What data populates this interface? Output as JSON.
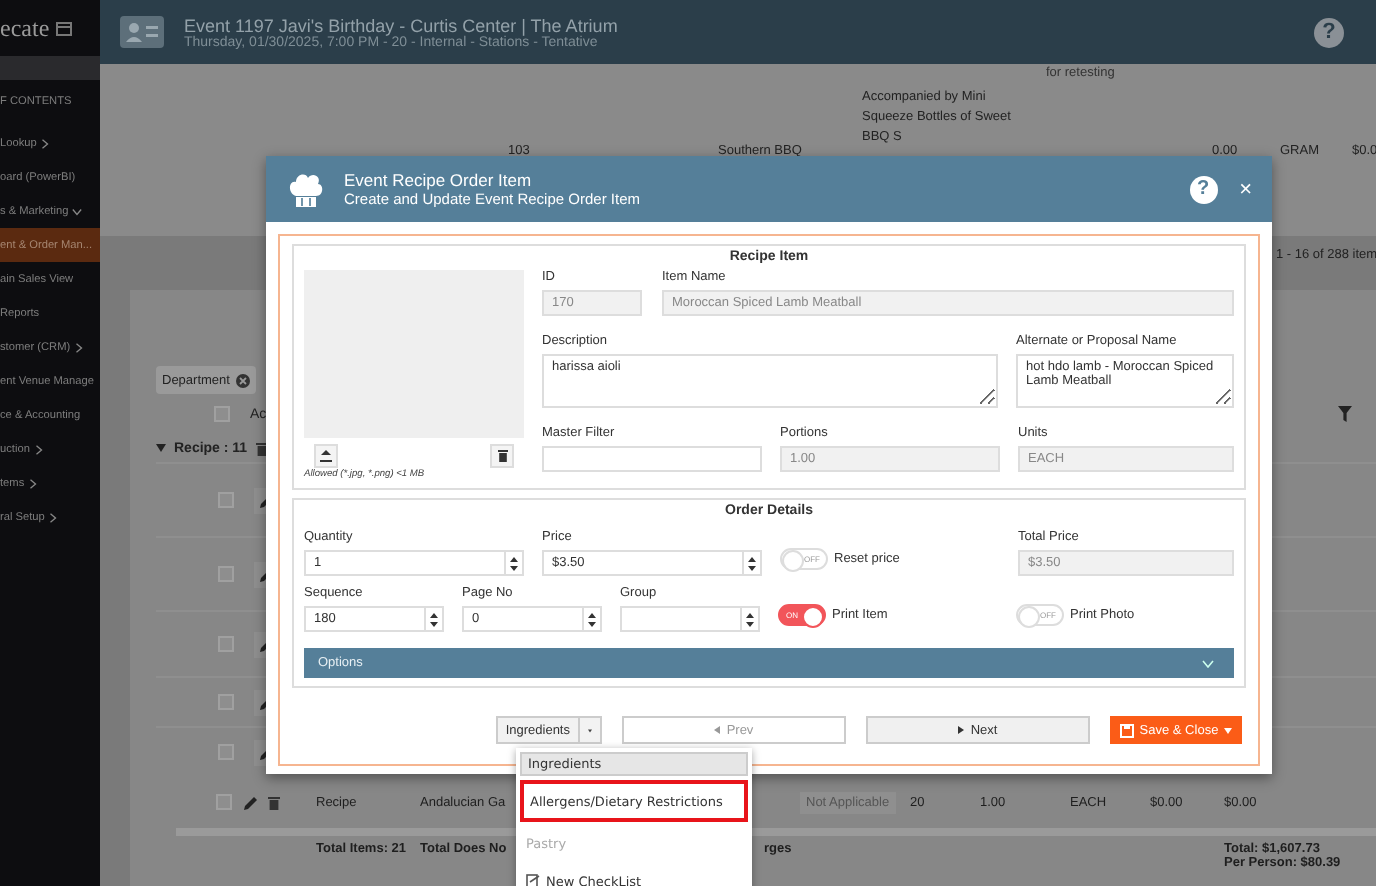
{
  "app": {
    "logo_text": "ecate",
    "header": {
      "title": "Event 1197 Javi's Birthday - Curtis Center | The Atrium",
      "subtitle": "Thursday, 01/30/2025, 7:00 PM - 20 - Internal - Stations - Tentative",
      "help": "?"
    }
  },
  "sidebar": {
    "heading": "F CONTENTS",
    "items": [
      {
        "label": "Lookup",
        "selected": false,
        "submenu": true,
        "expanded": false
      },
      {
        "label": "oard (PowerBI)",
        "selected": false
      },
      {
        "label": "s & Marketing",
        "selected": false,
        "submenu": true,
        "expanded": true
      },
      {
        "label": "ent & Order Man...",
        "selected": true
      },
      {
        "label": "ain Sales View",
        "selected": false
      },
      {
        "label": "Reports",
        "selected": false
      },
      {
        "label": "stomer (CRM)",
        "selected": false,
        "submenu": true,
        "expanded": false
      },
      {
        "label": "ent Venue Manage",
        "selected": false
      },
      {
        "label": "ce & Accounting",
        "selected": false
      },
      {
        "label": "uction",
        "selected": false,
        "submenu": true,
        "expanded": false
      },
      {
        "label": "tems",
        "selected": false,
        "submenu": true,
        "expanded": false
      },
      {
        "label": "ral Setup",
        "selected": false,
        "submenu": true,
        "expanded": false
      }
    ]
  },
  "background": {
    "top_row": {
      "note": "for retesting",
      "number": "103",
      "station": "Southern BBQ",
      "description": "Accompanied by Mini Squeeze Bottles of Sweet BBQ S",
      "quantity": "0.00",
      "unit": "GRAM",
      "price": "$0.0"
    },
    "pager": "1 - 16 of 288 item",
    "department_chip": "Department",
    "column_header": "Ac",
    "header_checked": false,
    "rows": [
      {
        "checked": false
      },
      {
        "checked": false
      },
      {
        "checked": false
      },
      {
        "checked": false
      },
      {
        "checked": false
      }
    ],
    "group": "Recipe : 11",
    "last_row": {
      "checked": false,
      "type": "Recipe",
      "name": "Andalucian Ga",
      "status": "Not Applicable",
      "guests": "20",
      "quantity": "1.00",
      "unit": "EACH",
      "price": "$0.00",
      "total": "$0.00"
    },
    "totals": {
      "items": "Total Items: 21",
      "note_start": "Total Does No",
      "note_end": "rges",
      "total": "Total: $1,607.73",
      "per_person": "Per Person: $80.39"
    }
  },
  "modal": {
    "title": "Event Recipe Order Item",
    "subtitle": "Create and Update Event Recipe Order Item",
    "help": "?",
    "close": "×",
    "recipe_item": {
      "heading": "Recipe Item",
      "image_note": "Allowed (*.jpg, *.png) <1 MB",
      "id": {
        "label": "ID",
        "value": "170",
        "disabled": true
      },
      "item_name": {
        "label": "Item Name",
        "value": "Moroccan Spiced Lamb Meatball",
        "disabled": true
      },
      "description": {
        "label": "Description",
        "value": "harissa aioli",
        "disabled": false
      },
      "alternate_name": {
        "label": "Alternate or Proposal Name",
        "value": "hot hdo lamb - Moroccan Spiced Lamb Meatball",
        "disabled": false
      },
      "master_filter": {
        "label": "Master Filter"
      },
      "portions": {
        "label": "Portions",
        "value": "1.00",
        "disabled": true
      },
      "units": {
        "label": "Units",
        "value": "EACH",
        "disabled": true
      }
    },
    "order_details": {
      "heading": "Order Details",
      "quantity": {
        "label": "Quantity",
        "value": "1"
      },
      "price": {
        "label": "Price",
        "value": "$3.50"
      },
      "reset_price": {
        "label": "Reset price",
        "on": false,
        "switch_text": "OFF"
      },
      "total_price": {
        "label": "Total Price",
        "value": "$3.50",
        "disabled": true
      },
      "sequence": {
        "label": "Sequence",
        "value": "180"
      },
      "page_no": {
        "label": "Page No",
        "value": "0"
      },
      "group": {
        "label": "Group"
      },
      "print_item": {
        "label": "Print Item",
        "on": true,
        "switch_text": "ON"
      },
      "print_photo": {
        "label": "Print Photo",
        "on": false,
        "switch_text": "OFF"
      },
      "options": {
        "label": "Options",
        "expanded": false
      }
    },
    "footer": {
      "menu_button": "Ingredients",
      "prev": "Prev",
      "next": "Next",
      "save": "Save & Close"
    },
    "menu": [
      {
        "label": "Ingredients",
        "kind": "option",
        "selected": true,
        "highlighted": false,
        "disabled": false
      },
      {
        "label": "Allergens/Dietary Restrictions",
        "kind": "option",
        "selected": false,
        "highlighted": true,
        "disabled": false
      },
      {
        "label": "Pastry",
        "kind": "option",
        "selected": false,
        "highlighted": false,
        "disabled": true
      },
      {
        "label": "New CheckList",
        "kind": "action",
        "selected": false,
        "highlighted": false,
        "disabled": false
      }
    ]
  }
}
